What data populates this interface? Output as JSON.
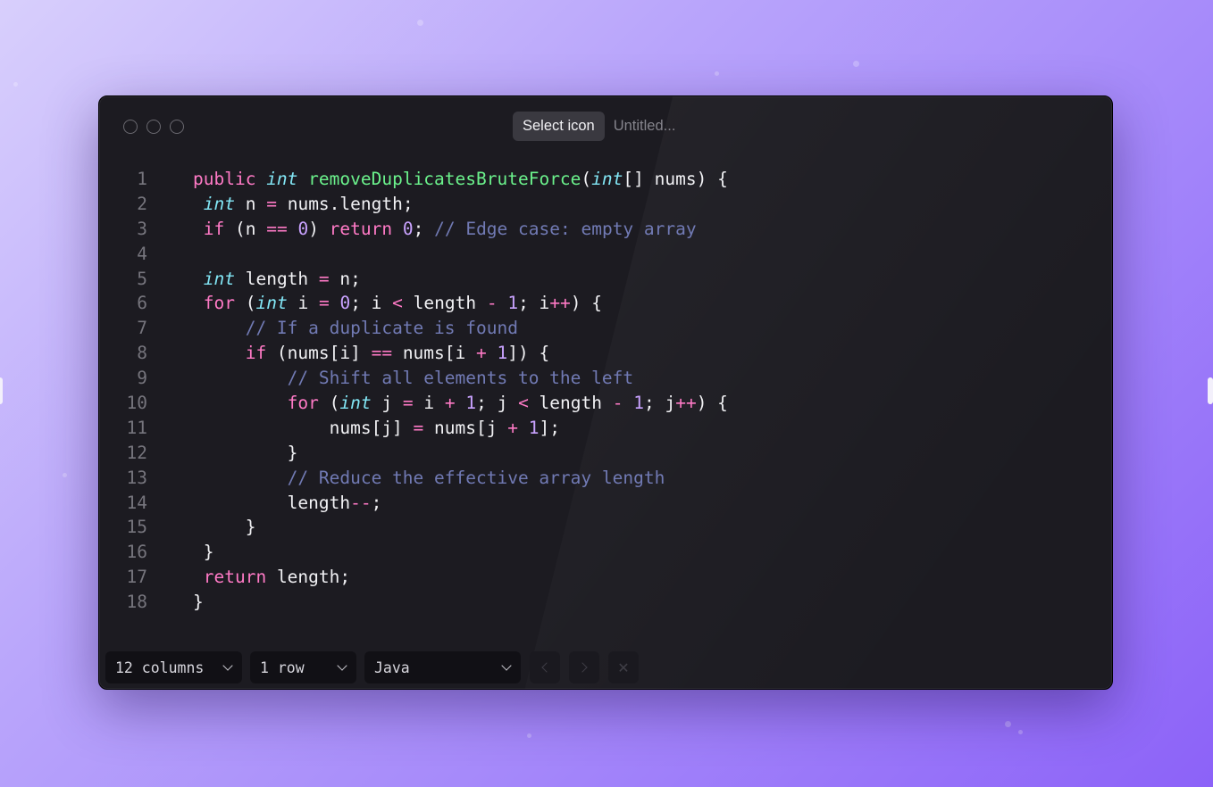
{
  "app": {
    "select_icon_label": "Select icon",
    "file_title": "Untitled..."
  },
  "code": {
    "language": "Java",
    "lines": [
      [
        {
          "t": "public ",
          "c": "kw"
        },
        {
          "t": "int",
          "c": "ty"
        },
        {
          "t": " "
        },
        {
          "t": "removeDuplicatesBruteForce",
          "c": "fn"
        },
        {
          "t": "("
        },
        {
          "t": "int",
          "c": "ty"
        },
        {
          "t": "[] nums) {"
        }
      ],
      [
        {
          "t": " "
        },
        {
          "t": "int",
          "c": "ty"
        },
        {
          "t": " n "
        },
        {
          "t": "=",
          "c": "op"
        },
        {
          "t": " nums.length;"
        }
      ],
      [
        {
          "t": " "
        },
        {
          "t": "if",
          "c": "kw"
        },
        {
          "t": " (n "
        },
        {
          "t": "==",
          "c": "op"
        },
        {
          "t": " "
        },
        {
          "t": "0",
          "c": "num"
        },
        {
          "t": ") "
        },
        {
          "t": "return",
          "c": "kw"
        },
        {
          "t": " "
        },
        {
          "t": "0",
          "c": "num"
        },
        {
          "t": "; "
        },
        {
          "t": "// Edge case: empty array",
          "c": "cm"
        }
      ],
      [],
      [
        {
          "t": " "
        },
        {
          "t": "int",
          "c": "ty"
        },
        {
          "t": " length "
        },
        {
          "t": "=",
          "c": "op"
        },
        {
          "t": " n;"
        }
      ],
      [
        {
          "t": " "
        },
        {
          "t": "for",
          "c": "kw"
        },
        {
          "t": " ("
        },
        {
          "t": "int",
          "c": "ty"
        },
        {
          "t": " i "
        },
        {
          "t": "=",
          "c": "op"
        },
        {
          "t": " "
        },
        {
          "t": "0",
          "c": "num"
        },
        {
          "t": "; i "
        },
        {
          "t": "<",
          "c": "op"
        },
        {
          "t": " length "
        },
        {
          "t": "-",
          "c": "op"
        },
        {
          "t": " "
        },
        {
          "t": "1",
          "c": "num"
        },
        {
          "t": "; i"
        },
        {
          "t": "++",
          "c": "op"
        },
        {
          "t": ") {"
        }
      ],
      [
        {
          "t": "     "
        },
        {
          "t": "// If a duplicate is found",
          "c": "cm"
        }
      ],
      [
        {
          "t": "     "
        },
        {
          "t": "if",
          "c": "kw"
        },
        {
          "t": " (nums[i] "
        },
        {
          "t": "==",
          "c": "op"
        },
        {
          "t": " nums[i "
        },
        {
          "t": "+",
          "c": "op"
        },
        {
          "t": " "
        },
        {
          "t": "1",
          "c": "num"
        },
        {
          "t": "]) {"
        }
      ],
      [
        {
          "t": "         "
        },
        {
          "t": "// Shift all elements to the left",
          "c": "cm"
        }
      ],
      [
        {
          "t": "         "
        },
        {
          "t": "for",
          "c": "kw"
        },
        {
          "t": " ("
        },
        {
          "t": "int",
          "c": "ty"
        },
        {
          "t": " j "
        },
        {
          "t": "=",
          "c": "op"
        },
        {
          "t": " i "
        },
        {
          "t": "+",
          "c": "op"
        },
        {
          "t": " "
        },
        {
          "t": "1",
          "c": "num"
        },
        {
          "t": "; j "
        },
        {
          "t": "<",
          "c": "op"
        },
        {
          "t": " length "
        },
        {
          "t": "-",
          "c": "op"
        },
        {
          "t": " "
        },
        {
          "t": "1",
          "c": "num"
        },
        {
          "t": "; j"
        },
        {
          "t": "++",
          "c": "op"
        },
        {
          "t": ") {"
        }
      ],
      [
        {
          "t": "             nums[j] "
        },
        {
          "t": "=",
          "c": "op"
        },
        {
          "t": " nums[j "
        },
        {
          "t": "+",
          "c": "op"
        },
        {
          "t": " "
        },
        {
          "t": "1",
          "c": "num"
        },
        {
          "t": "];"
        }
      ],
      [
        {
          "t": "         }"
        }
      ],
      [
        {
          "t": "         "
        },
        {
          "t": "// Reduce the effective array length",
          "c": "cm"
        }
      ],
      [
        {
          "t": "         length"
        },
        {
          "t": "--",
          "c": "op"
        },
        {
          "t": ";"
        }
      ],
      [
        {
          "t": "     }"
        }
      ],
      [
        {
          "t": " }"
        }
      ],
      [
        {
          "t": " "
        },
        {
          "t": "return",
          "c": "kw"
        },
        {
          "t": " length;"
        }
      ],
      [
        {
          "t": "}"
        }
      ]
    ]
  },
  "toolbar": {
    "columns_label": "12 columns",
    "rows_label": "1 row",
    "language_label": "Java",
    "prev_icon": "chevron-left-icon",
    "next_icon": "chevron-right-icon",
    "close_icon": "close-icon"
  },
  "colors": {
    "keyword": "#ff7ac6",
    "type": "#82e6f5",
    "function": "#6bf28c",
    "number": "#c9a2ff",
    "comment": "#717ab4",
    "window_bg": "#1c1b21"
  }
}
